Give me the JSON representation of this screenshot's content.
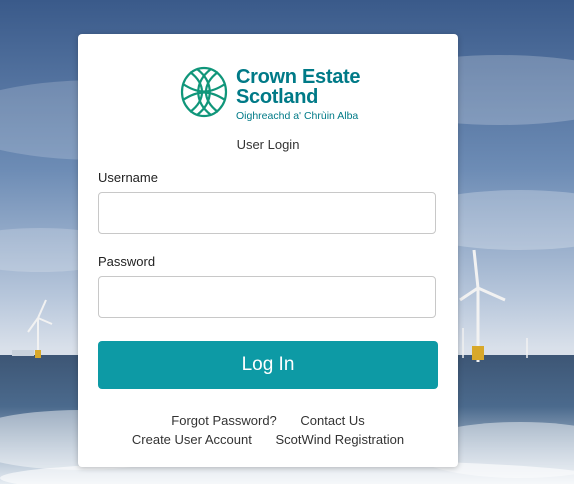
{
  "brand": {
    "line1": "Crown Estate",
    "line2": "Scotland",
    "tagline": "Oighreachd a' Chrùin Alba",
    "color": "#007a87"
  },
  "page": {
    "subtitle": "User Login"
  },
  "form": {
    "username_label": "Username",
    "username_value": "",
    "password_label": "Password",
    "password_value": "",
    "login_label": "Log In",
    "button_color": "#0d9aa5"
  },
  "links": {
    "forgot_password": "Forgot Password?",
    "contact_us": "Contact Us",
    "create_account": "Create User Account",
    "scotwind_registration": "ScotWind Registration"
  },
  "background": {
    "icons": [
      "wind-turbine-icon"
    ]
  }
}
